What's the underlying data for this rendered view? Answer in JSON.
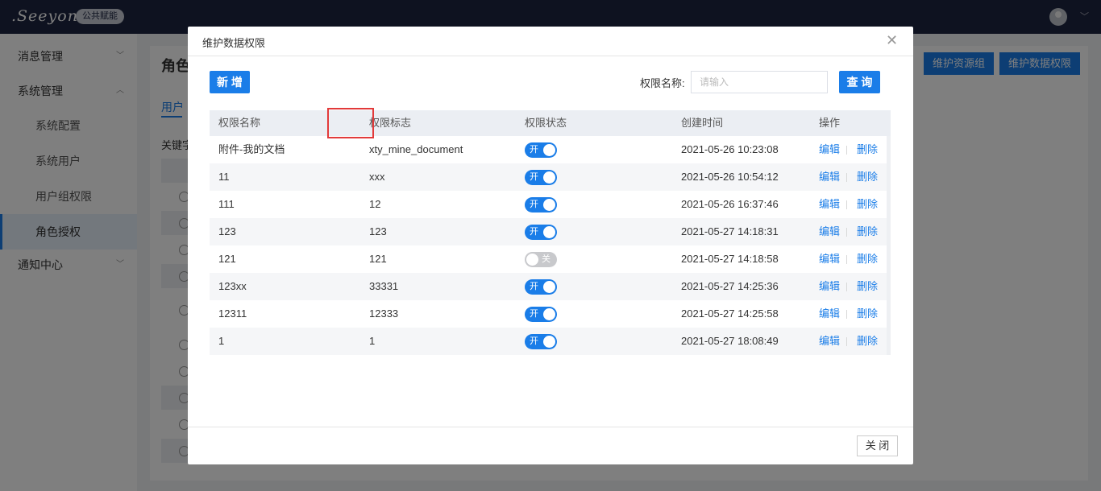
{
  "header": {
    "logo": ".Seeyon",
    "logo_tag": "公共赋能"
  },
  "sidebar": {
    "items": [
      {
        "label": "消息管理"
      },
      {
        "label": "系统管理"
      },
      {
        "label": "系统配置"
      },
      {
        "label": "系统用户"
      },
      {
        "label": "用户组权限"
      },
      {
        "label": "角色授权"
      },
      {
        "label": "通知中心"
      }
    ]
  },
  "background": {
    "page_title": "角色",
    "tab": "用户",
    "keyword_label": "关键字",
    "btn_resource_group": "维护资源组",
    "btn_data_permission": "维护数据权限"
  },
  "modal": {
    "title": "维护数据权限",
    "add_button": "新 增",
    "search_label": "权限名称:",
    "search_placeholder": "请输入",
    "search_value": "",
    "query_button": "查 询",
    "close_button": "关 闭",
    "columns": [
      "权限名称",
      "权限标志",
      "权限状态",
      "创建时间",
      "操作"
    ],
    "rows": [
      {
        "name": "附件-我的文档",
        "flag": "xty_mine_document",
        "status_label": "开",
        "enabled": true,
        "created": "2021-05-26 10:23:08",
        "edit": "编辑",
        "delete": "删除"
      },
      {
        "name": "11",
        "flag": "xxx",
        "status_label": "开",
        "enabled": true,
        "created": "2021-05-26 10:54:12",
        "edit": "编辑",
        "delete": "删除"
      },
      {
        "name": "111",
        "flag": "12",
        "status_label": "开",
        "enabled": true,
        "created": "2021-05-26 16:37:46",
        "edit": "编辑",
        "delete": "删除"
      },
      {
        "name": "123",
        "flag": "123",
        "status_label": "开",
        "enabled": true,
        "created": "2021-05-27 14:18:31",
        "edit": "编辑",
        "delete": "删除"
      },
      {
        "name": "121",
        "flag": "121",
        "status_label": "关",
        "enabled": false,
        "created": "2021-05-27 14:18:58",
        "edit": "编辑",
        "delete": "删除"
      },
      {
        "name": "123xx",
        "flag": "33331",
        "status_label": "开",
        "enabled": true,
        "created": "2021-05-27 14:25:36",
        "edit": "编辑",
        "delete": "删除"
      },
      {
        "name": "12311",
        "flag": "12333",
        "status_label": "开",
        "enabled": true,
        "created": "2021-05-27 14:25:58",
        "edit": "编辑",
        "delete": "删除"
      },
      {
        "name": "1",
        "flag": "1",
        "status_label": "开",
        "enabled": true,
        "created": "2021-05-27 18:08:49",
        "edit": "编辑",
        "delete": "删除"
      }
    ]
  },
  "colors": {
    "primary": "#1a7de8",
    "topbar": "#1c2540",
    "highlight": "#e23a3a",
    "toggle_off": "#c8c9cc"
  }
}
